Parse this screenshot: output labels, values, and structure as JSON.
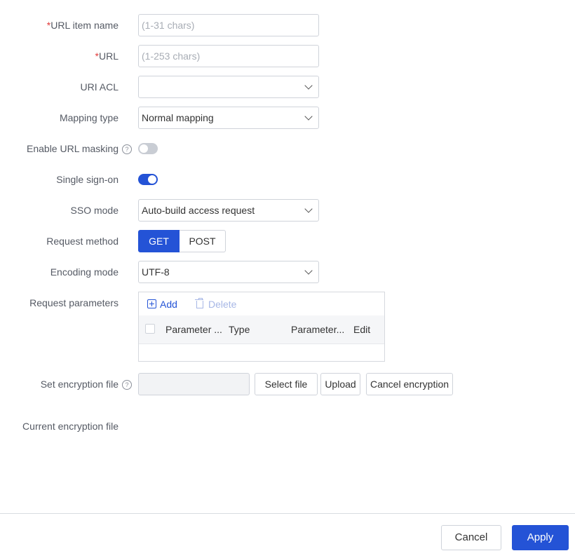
{
  "form": {
    "url_item_name": {
      "required_mark": "*",
      "label": "URL item name",
      "placeholder": "(1-31 chars)",
      "value": ""
    },
    "url": {
      "required_mark": "*",
      "label": "URL",
      "placeholder": "(1-253 chars)",
      "value": ""
    },
    "uri_acl": {
      "label": "URI ACL",
      "value": ""
    },
    "mapping_type": {
      "label": "Mapping type",
      "value": "Normal mapping"
    },
    "url_masking": {
      "label": "Enable URL masking",
      "help_icon": "?",
      "enabled": false
    },
    "single_sign_on": {
      "label": "Single sign-on",
      "enabled": true
    },
    "sso_mode": {
      "label": "SSO mode",
      "value": "Auto-build access request"
    },
    "request_method": {
      "label": "Request method",
      "options": [
        "GET",
        "POST"
      ],
      "selected": "GET"
    },
    "encoding_mode": {
      "label": "Encoding mode",
      "value": "UTF-8"
    },
    "request_parameters": {
      "label": "Request parameters",
      "add_label": "Add",
      "delete_label": "Delete",
      "columns": [
        "Parameter ...",
        "Type",
        "Parameter...",
        "Edit"
      ],
      "rows": []
    },
    "encryption_file": {
      "label": "Set encryption file",
      "help_icon": "?",
      "value": "",
      "select_label": "Select file",
      "upload_label": "Upload",
      "cancel_label": "Cancel encryption"
    },
    "current_encryption_file": {
      "label": "Current encryption file",
      "value": ""
    }
  },
  "footer": {
    "cancel_label": "Cancel",
    "apply_label": "Apply"
  },
  "colors": {
    "primary": "#2453d6",
    "required": "#e23b3b",
    "border": "#cfd3da"
  }
}
